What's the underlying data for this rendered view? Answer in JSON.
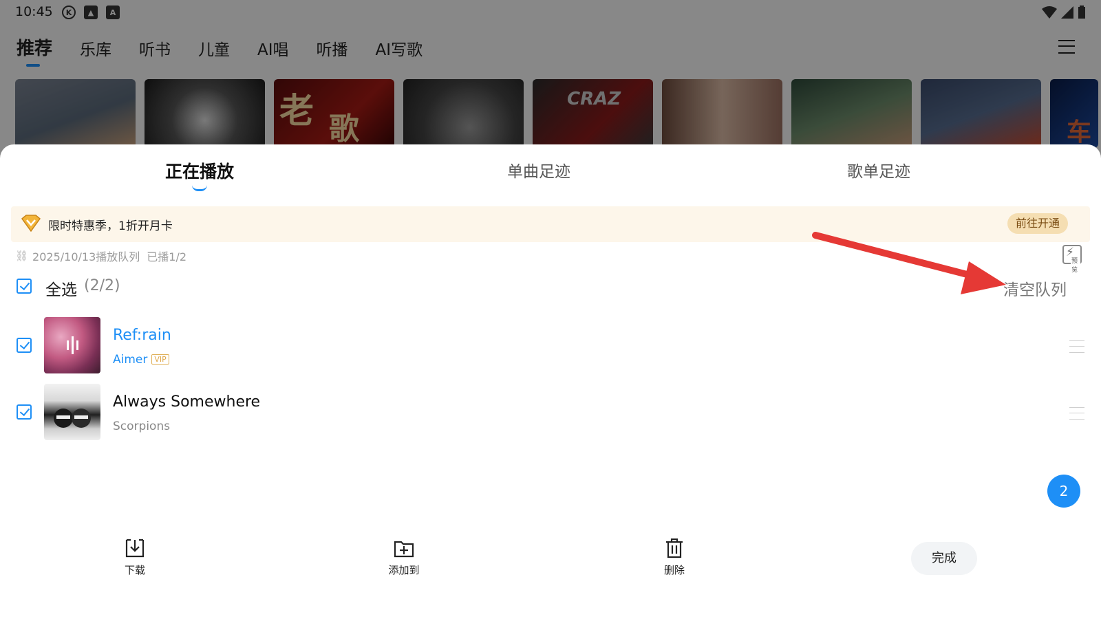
{
  "status_bar": {
    "time": "10:45"
  },
  "top_nav": {
    "tabs": [
      {
        "label": "推荐",
        "active": true
      },
      {
        "label": "乐库"
      },
      {
        "label": "听书"
      },
      {
        "label": "儿童"
      },
      {
        "label": "AI唱"
      },
      {
        "label": "听播"
      },
      {
        "label": "AI写歌"
      }
    ]
  },
  "cover_texts": {
    "c2_a": "老",
    "c2_b": "歌",
    "c4": "CRAZ",
    "c8": "车"
  },
  "sheet": {
    "tabs": [
      "正在播放",
      "单曲足迹",
      "歌单足迹"
    ],
    "active_tab_index": 0,
    "promo": {
      "text": "限时特惠季，1折开月卡",
      "button": "前往开通"
    },
    "queue_info": {
      "date_label": "2025/10/13播放队列",
      "played": "已播1/2"
    },
    "preview_label": "预览",
    "select_all": {
      "label": "全选",
      "count": "(2/2)",
      "checked": true
    },
    "clear_queue": "清空队列",
    "songs": [
      {
        "title": "Ref:rain",
        "artist": "Aimer",
        "vip": "VIP",
        "playing": true,
        "checked": true
      },
      {
        "title": "Always Somewhere",
        "artist": "Scorpions",
        "playing": false,
        "checked": true
      }
    ],
    "selected_badge": "2",
    "actions": {
      "download": "下载",
      "add_to": "添加到",
      "delete": "删除"
    },
    "done": "完成"
  },
  "colors": {
    "accent": "#1e8ff6",
    "promo_bg": "#fdf6ea",
    "arrow": "#e53935"
  }
}
